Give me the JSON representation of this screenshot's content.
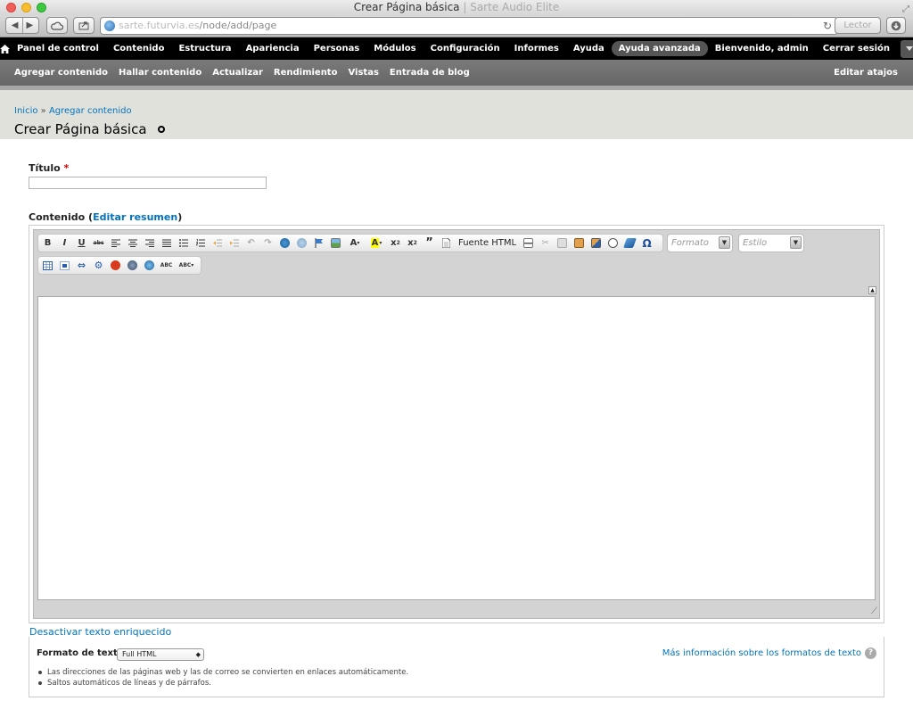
{
  "window": {
    "title": "Crear Página básica",
    "title_site": " | Sarte Audio Elite"
  },
  "browser": {
    "url_host": "sarte.futurvia.es",
    "url_path": "/node/add/page",
    "reader_label": "Lector"
  },
  "admin_menu": {
    "items": [
      "Panel de control",
      "Contenido",
      "Estructura",
      "Apariencia",
      "Personas",
      "Módulos",
      "Configuración",
      "Informes",
      "Ayuda",
      "Ayuda avanzada"
    ],
    "welcome_prefix": "Bienvenido, ",
    "welcome_user": "admin",
    "logout": "Cerrar sesión"
  },
  "shortcuts": {
    "items": [
      "Agregar contenido",
      "Hallar contenido",
      "Actualizar",
      "Rendimiento",
      "Vistas",
      "Entrada de blog"
    ],
    "edit": "Editar atajos"
  },
  "breadcrumb": {
    "home": "Inicio",
    "sep": " » ",
    "current": "Agregar contenido"
  },
  "page": {
    "title": "Crear Página básica"
  },
  "form": {
    "title_label": "Título",
    "required_mark": "*",
    "title_value": "",
    "body_label": "Contenido",
    "summary_open": " (",
    "summary_link": "Editar resumen",
    "summary_close": ")",
    "toggle_rich": "Desactivar texto enriquecido"
  },
  "editor": {
    "source_label": "Fuente HTML",
    "format_placeholder": "Formato",
    "style_placeholder": "Estilo"
  },
  "text_format": {
    "label": "Formato de texto",
    "selected": "Full HTML",
    "more_link": "Más información sobre los formatos de texto",
    "tips": [
      "Las direcciones de las páginas web y las de correo se convierten en enlaces automáticamente.",
      "Saltos automáticos de líneas y de párrafos."
    ]
  },
  "colors": {
    "link": "#0074bd",
    "admin_bar": "#000000",
    "shortcut_bar": "#6e6e6e",
    "header_bg": "#e1e1dc"
  }
}
